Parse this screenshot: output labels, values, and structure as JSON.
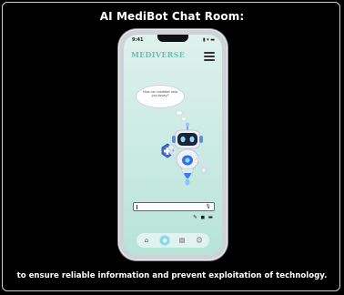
{
  "headline": "AI MediBot Chat Room:",
  "caption": "to ensure reliable information and prevent exploitation of technology.",
  "phone": {
    "status_time": "9:41",
    "status_icons": "▮ ▾ ▬",
    "brand": "MEDIVERSE",
    "bubble_text": "How can medibot help you today?",
    "chat_input_value": "",
    "tools_icons": "✎ ◼ ▬",
    "nav": [
      "⌂",
      "◉",
      "▤",
      "☺"
    ]
  },
  "colors": {
    "background": "#000000",
    "screen_top": "#dff1ec",
    "screen_bottom": "#b7e3d8",
    "brand": "#6cbfb0",
    "nav_active": "#7fd3e2"
  }
}
